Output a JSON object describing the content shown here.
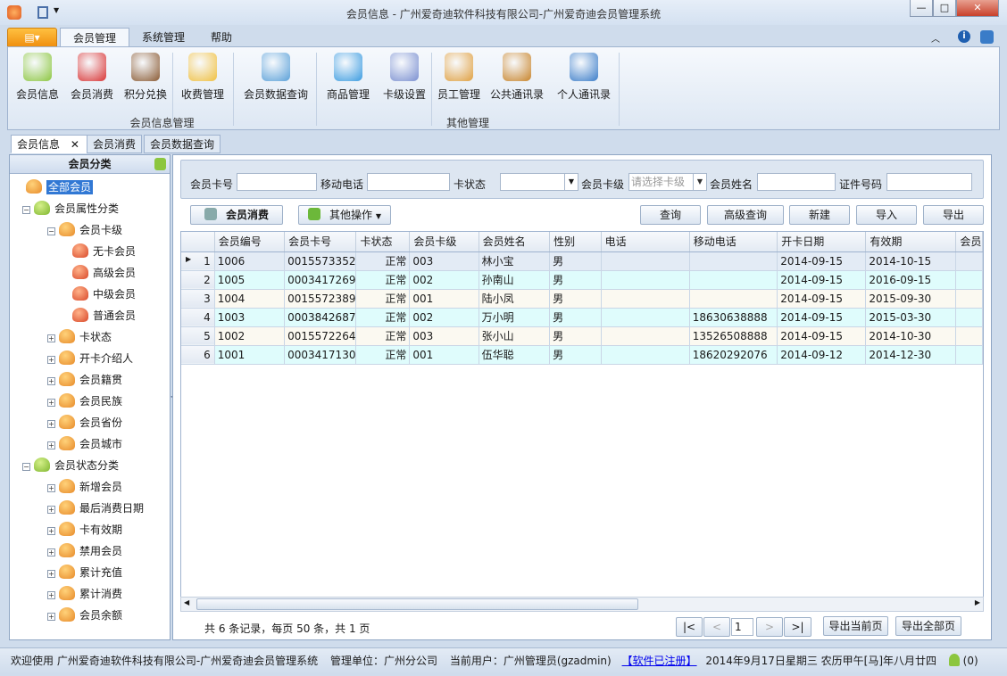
{
  "window": {
    "title": "会员信息 - 广州爱奇迪软件科技有限公司-广州爱奇迪会员管理系统",
    "controls": [
      "—",
      "□",
      "✕"
    ]
  },
  "ribbon": {
    "tabs": [
      {
        "label": "会员管理",
        "active": true
      },
      {
        "label": "系统管理"
      },
      {
        "label": "帮助"
      }
    ],
    "buttons": [
      {
        "label": "会员信息",
        "icon": "members-icon",
        "color": "#8cc63f"
      },
      {
        "label": "会员消费",
        "icon": "basket-icon",
        "color": "#d93434"
      },
      {
        "label": "积分兑换",
        "icon": "teddy-bear-icon",
        "color": "#8a5a33"
      },
      {
        "label": "收费管理",
        "icon": "coins-icon",
        "color": "#f0c040"
      },
      {
        "label": "会员数据查询",
        "icon": "search-document-icon",
        "color": "#5aa0d8"
      },
      {
        "label": "商品管理",
        "icon": "shapes-icon",
        "color": "#3a9be0"
      },
      {
        "label": "卡级设置",
        "icon": "id-card-icon",
        "color": "#7a8fd0"
      },
      {
        "label": "员工管理",
        "icon": "employee-icon",
        "color": "#e0a040"
      },
      {
        "label": "公共通讯录",
        "icon": "address-book-icon",
        "color": "#c8842a"
      },
      {
        "label": "个人通讯录",
        "icon": "personal-book-icon",
        "color": "#3a7cc8"
      }
    ],
    "groups": [
      "会员信息管理",
      "其他管理"
    ]
  },
  "doc_tabs": [
    "会员信息",
    "会员消费",
    "会员数据查询"
  ],
  "tree": {
    "title": "会员分类",
    "nodes": [
      {
        "label": "全部会员",
        "level": 0,
        "selected": true
      },
      {
        "label": "会员属性分类",
        "level": 1
      },
      {
        "label": "会员卡级",
        "level": 2
      },
      {
        "label": "无卡会员",
        "level": 3
      },
      {
        "label": "高级会员",
        "level": 3
      },
      {
        "label": "中级会员",
        "level": 3
      },
      {
        "label": "普通会员",
        "level": 3
      },
      {
        "label": "卡状态",
        "level": 2
      },
      {
        "label": "开卡介绍人",
        "level": 2
      },
      {
        "label": "会员籍贯",
        "level": 2
      },
      {
        "label": "会员民族",
        "level": 2
      },
      {
        "label": "会员省份",
        "level": 2
      },
      {
        "label": "会员城市",
        "level": 2
      },
      {
        "label": "会员状态分类",
        "level": 1
      },
      {
        "label": "新增会员",
        "level": 2
      },
      {
        "label": "最后消费日期",
        "level": 2
      },
      {
        "label": "卡有效期",
        "level": 2
      },
      {
        "label": "禁用会员",
        "level": 2
      },
      {
        "label": "累计充值",
        "level": 2
      },
      {
        "label": "累计消费",
        "level": 2
      },
      {
        "label": "会员余额",
        "level": 2
      }
    ]
  },
  "search": {
    "card_no": "会员卡号",
    "mobile": "移动电话",
    "card_status": "卡状态",
    "card_level": "会员卡级",
    "card_level_placeholder": "请选择卡级",
    "name": "会员姓名",
    "id_no": "证件号码"
  },
  "actions": {
    "consume": "会员消费",
    "other": "其他操作",
    "query": "查询",
    "advanced": "高级查询",
    "new": "新建",
    "import": "导入",
    "export": "导出"
  },
  "grid": {
    "columns": [
      "会员编号",
      "会员卡号",
      "卡状态",
      "会员卡级",
      "会员姓名",
      "性别",
      "电话",
      "移动电话",
      "开卡日期",
      "有效期",
      "会员"
    ],
    "rows": [
      [
        "1",
        "1006",
        "0015573352",
        "正常",
        "003",
        "林小宝",
        "男",
        "",
        "",
        "2014-09-15",
        "2014-10-15"
      ],
      [
        "2",
        "1005",
        "0003417269",
        "正常",
        "002",
        "孙南山",
        "男",
        "",
        "",
        "2014-09-15",
        "2016-09-15"
      ],
      [
        "3",
        "1004",
        "0015572389",
        "正常",
        "001",
        "陆小凤",
        "男",
        "",
        "",
        "2014-09-15",
        "2015-09-30"
      ],
      [
        "4",
        "1003",
        "0003842687",
        "正常",
        "002",
        "万小明",
        "男",
        "",
        "18630638888",
        "2014-09-15",
        "2015-03-30"
      ],
      [
        "5",
        "1002",
        "0015572264",
        "正常",
        "003",
        "张小山",
        "男",
        "",
        "13526508888",
        "2014-09-15",
        "2014-10-30"
      ],
      [
        "6",
        "1001",
        "0003417130",
        "正常",
        "001",
        "伍华聪",
        "男",
        "",
        "18620292076",
        "2014-09-12",
        "2014-12-30"
      ]
    ]
  },
  "pager": {
    "summary": "共 6 条记录，每页 50 条，共 1 页",
    "first": "|<",
    "prev": "<",
    "page": "1",
    "next": ">",
    "last": ">|",
    "export_page": "导出当前页",
    "export_all": "导出全部页"
  },
  "status": {
    "welcome": "欢迎使用 广州爱奇迪软件科技有限公司-广州爱奇迪会员管理系统",
    "unit": "管理单位：广州分公司",
    "user": "当前用户：广州管理员(gzadmin)",
    "registered": "【软件已注册】",
    "date": "2014年9月17日星期三 农历甲午[马]年八月廿四",
    "count": "(0)"
  }
}
